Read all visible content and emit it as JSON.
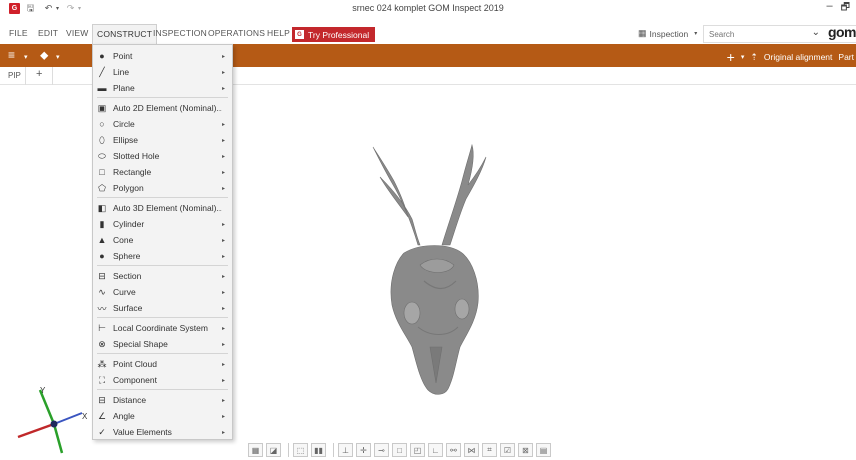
{
  "window": {
    "title": "srnec 024 komplet   GOM Inspect 2019",
    "minimize": "–",
    "restore": "🗗"
  },
  "menubar": {
    "items": [
      "FILE",
      "EDIT",
      "VIEW",
      "CONSTRUCT",
      "INSPECTION",
      "OPERATIONS",
      "HELP"
    ],
    "active": "CONSTRUCT",
    "try_professional": "Try Professional",
    "workspace": "Inspection",
    "search_placeholder": "Search",
    "brand": "gom"
  },
  "toolbar": {
    "alignment_label": "Original alignment",
    "part_label": "Part"
  },
  "panel_tabs": {
    "pip": "PIP",
    "add": "+"
  },
  "construct_menu": {
    "items": [
      {
        "icon": "point-icon",
        "label": "Point"
      },
      {
        "icon": "line-icon",
        "label": "Line"
      },
      {
        "icon": "plane-icon",
        "label": "Plane"
      },
      {
        "icon": "auto-2d-icon",
        "label": "Auto 2D Element (Nominal)..."
      },
      {
        "icon": "circle-icon",
        "label": "Circle"
      },
      {
        "icon": "ellipse-icon",
        "label": "Ellipse"
      },
      {
        "icon": "slotted-hole-icon",
        "label": "Slotted Hole"
      },
      {
        "icon": "rectangle-icon",
        "label": "Rectangle"
      },
      {
        "icon": "polygon-icon",
        "label": "Polygon"
      },
      {
        "icon": "auto-3d-icon",
        "label": "Auto 3D Element (Nominal)..."
      },
      {
        "icon": "cylinder-icon",
        "label": "Cylinder"
      },
      {
        "icon": "cone-icon",
        "label": "Cone"
      },
      {
        "icon": "sphere-icon",
        "label": "Sphere"
      },
      {
        "icon": "section-icon",
        "label": "Section"
      },
      {
        "icon": "curve-icon",
        "label": "Curve"
      },
      {
        "icon": "surface-icon",
        "label": "Surface"
      },
      {
        "icon": "local-coordinate-system-icon",
        "label": "Local Coordinate System"
      },
      {
        "icon": "special-shape-icon",
        "label": "Special Shape"
      },
      {
        "icon": "point-cloud-icon",
        "label": "Point Cloud"
      },
      {
        "icon": "component-icon",
        "label": "Component"
      },
      {
        "icon": "distance-icon",
        "label": "Distance"
      },
      {
        "icon": "angle-icon",
        "label": "Angle"
      },
      {
        "icon": "value-elements-icon",
        "label": "Value Elements"
      }
    ]
  },
  "axes": {
    "y": "Y",
    "x": "X"
  },
  "colors": {
    "toolbar": "#b55a15",
    "accent_red": "#c3282c",
    "model_gray": "#8a8a8a"
  }
}
